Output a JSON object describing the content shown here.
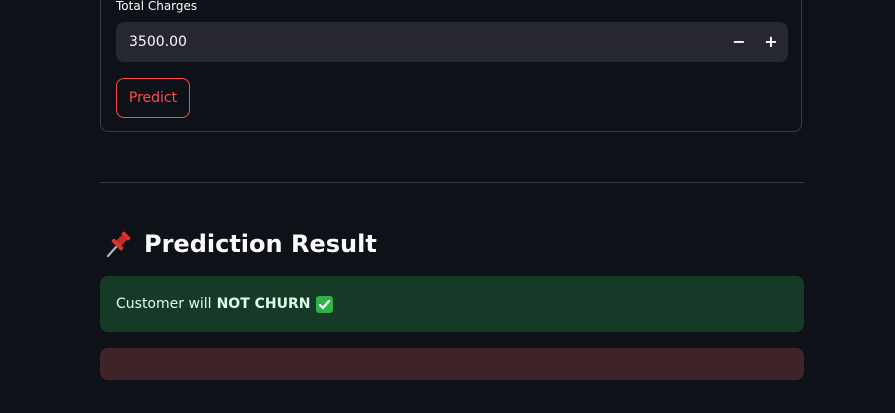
{
  "form": {
    "total_charges_label": "Total Charges",
    "total_charges_value": "3500.00",
    "decrement_label": "−",
    "increment_label": "+",
    "predict_button": "Predict"
  },
  "result": {
    "heading": "Prediction Result",
    "heading_icon": "pushpin-icon",
    "message_prefix": "Customer will",
    "message_bold": "NOT CHURN",
    "message_icon": "check-mark-icon"
  },
  "colors": {
    "background": "#0e1117",
    "accent": "#ff4b4b",
    "success_bg": "#173928",
    "error_bg": "#3e2428"
  }
}
